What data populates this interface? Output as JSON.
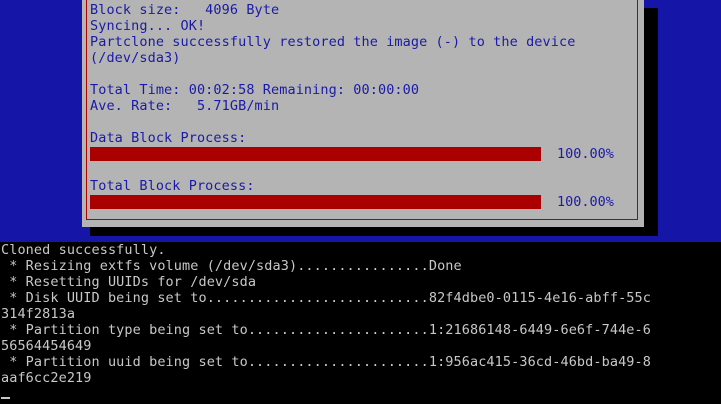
{
  "dialog": {
    "lines": [
      "Block size:   4096 Byte",
      "Syncing... OK!",
      "Partclone successfully restored the image (-) to the device",
      "(/dev/sda3)",
      "",
      "Total Time: 00:02:58 Remaining: 00:00:00",
      "Ave. Rate:   5.71GB/min"
    ],
    "data_block_label": "Data Block Process:",
    "data_block_progress": 1.0,
    "data_block_percent": "100.00%",
    "total_block_label": "Total Block Process:",
    "total_block_progress": 1.0,
    "total_block_percent": "100.00%"
  },
  "terminal": {
    "lines": [
      "Cloned successfully.",
      " * Resizing extfs volume (/dev/sda3)................Done",
      " * Resetting UUIDs for /dev/sda",
      " * Disk UUID being set to...........................82f4dbe0-0115-4e16-abff-55c",
      "314f2813a",
      " * Partition type being set to......................1:21686148-6449-6e6f-744e-6",
      "56564454649",
      " * Partition uuid being set to......................1:956ac415-36cd-46bd-ba49-8",
      "aaf6cc2e219"
    ]
  },
  "colors": {
    "screen_bg": "#1515a8",
    "dialog_bg": "#b4b4b4",
    "dialog_text": "#1a1aa8",
    "progress_bar": "#aa0000",
    "terminal_text": "#c8c8c8"
  }
}
